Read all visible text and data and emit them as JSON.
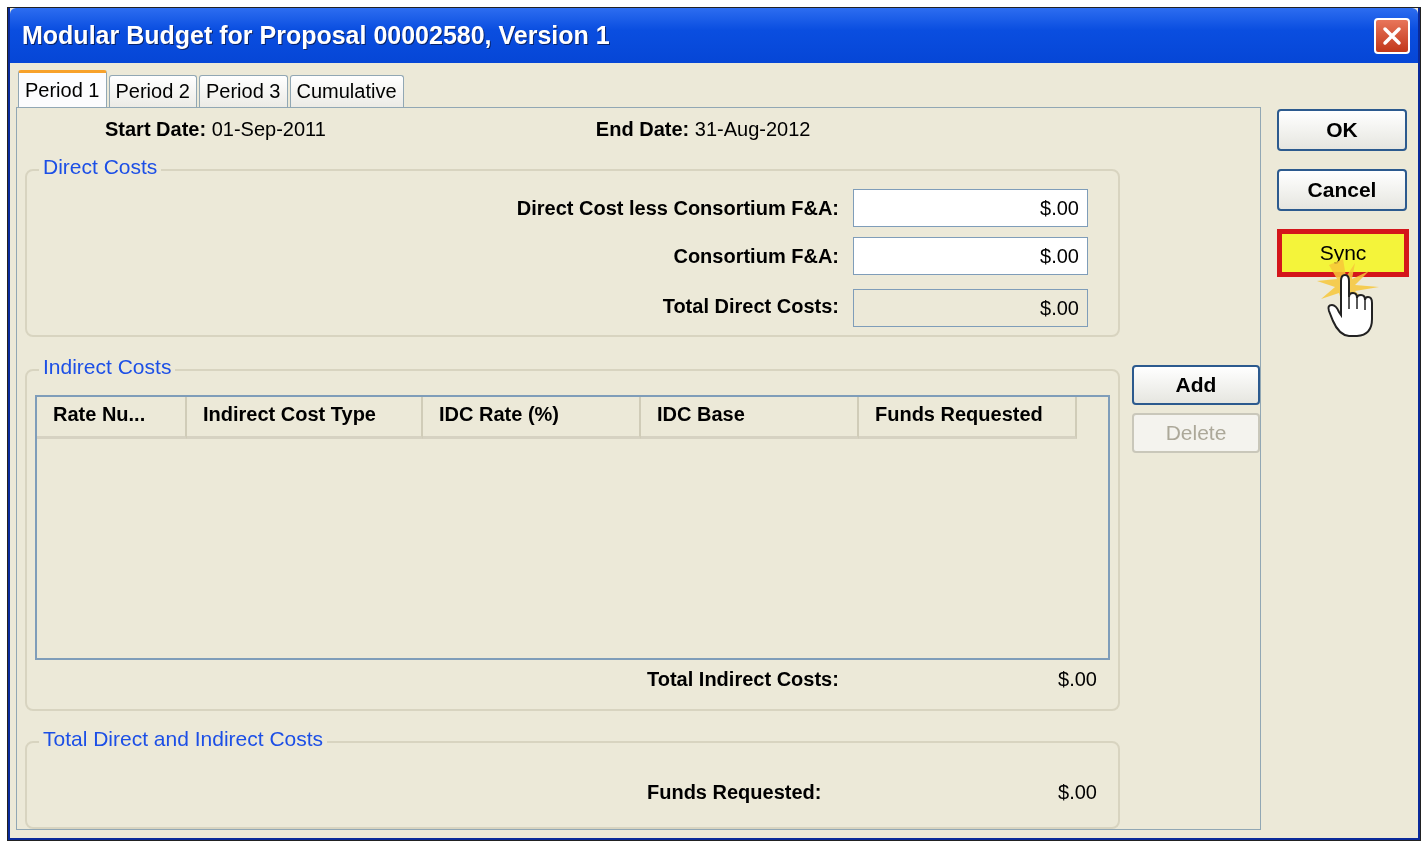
{
  "window": {
    "title": "Modular Budget for Proposal 00002580, Version 1"
  },
  "tabs": [
    {
      "label": "Period 1",
      "selected": true
    },
    {
      "label": "Period 2",
      "selected": false
    },
    {
      "label": "Period 3",
      "selected": false
    },
    {
      "label": "Cumulative",
      "selected": false
    }
  ],
  "dates": {
    "start_label": "Start Date:",
    "start": "01-Sep-2011",
    "end_label": "End Date:",
    "end": "31-Aug-2012"
  },
  "direct_costs": {
    "title": "Direct Costs",
    "fields": [
      {
        "label": "Direct Cost less Consortium F&A:",
        "value": "$.00",
        "disabled": false
      },
      {
        "label": "Consortium F&A:",
        "value": "$.00",
        "disabled": false
      },
      {
        "label": "Total Direct Costs:",
        "value": "$.00",
        "disabled": true
      }
    ]
  },
  "indirect_costs": {
    "title": "Indirect Costs",
    "columns": [
      "Rate Nu...",
      "Indirect Cost Type",
      "IDC Rate (%)",
      "IDC Base",
      "Funds Requested"
    ],
    "total_label": "Total Indirect Costs:",
    "total": "$.00"
  },
  "row_buttons": [
    {
      "label": "Add",
      "disabled": false
    },
    {
      "label": "Delete",
      "disabled": true
    }
  ],
  "total_costs": {
    "title": "Total Direct and Indirect Costs",
    "label": "Funds Requested:",
    "value": "$.00"
  },
  "buttons": [
    {
      "label": "OK",
      "kind": "normal"
    },
    {
      "label": "Cancel",
      "kind": "normal"
    },
    {
      "label": "Sync",
      "kind": "highlighted"
    }
  ]
}
